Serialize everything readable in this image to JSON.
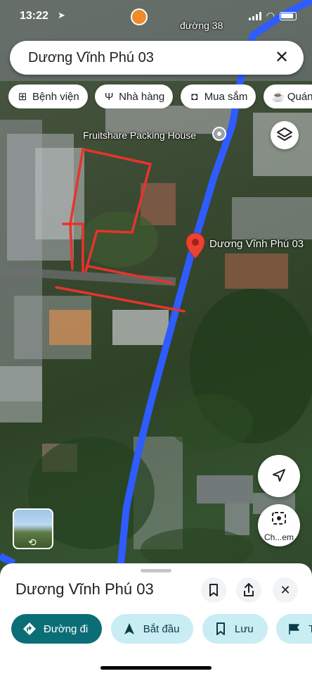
{
  "status": {
    "time": "13:22",
    "location_label": "đường 38"
  },
  "search": {
    "query": "Dương Vĩnh Phú 03"
  },
  "categories": [
    {
      "label": "Bệnh viện",
      "icon": "hospital-icon"
    },
    {
      "label": "Nhà hàng",
      "icon": "restaurant-icon"
    },
    {
      "label": "Mua sắm",
      "icon": "shopping-bag-icon"
    },
    {
      "label": "Quán",
      "icon": "coffee-icon"
    }
  ],
  "map": {
    "road_label": "đường 38",
    "poi_label": "Fruitshare Packing House",
    "pin_label": "Dương Vĩnh Phú 03",
    "road_color": "#2e5cff",
    "plot_outline_color": "#e8332d"
  },
  "lens": {
    "label": "Ch...em"
  },
  "place": {
    "title": "Dương Vĩnh Phú 03",
    "actions": [
      {
        "label": "Đường đi",
        "icon": "directions-icon",
        "style": "primary"
      },
      {
        "label": "Bắt đầu",
        "icon": "navigation-arrow-icon",
        "style": "secondary"
      },
      {
        "label": "Lưu",
        "icon": "bookmark-icon",
        "style": "secondary"
      },
      {
        "label": "Th",
        "icon": "label-flag-icon",
        "style": "secondary"
      }
    ]
  },
  "colors": {
    "accent": "#0b6e77",
    "accent_light": "#c8edf2",
    "pin": "#ea4335"
  }
}
